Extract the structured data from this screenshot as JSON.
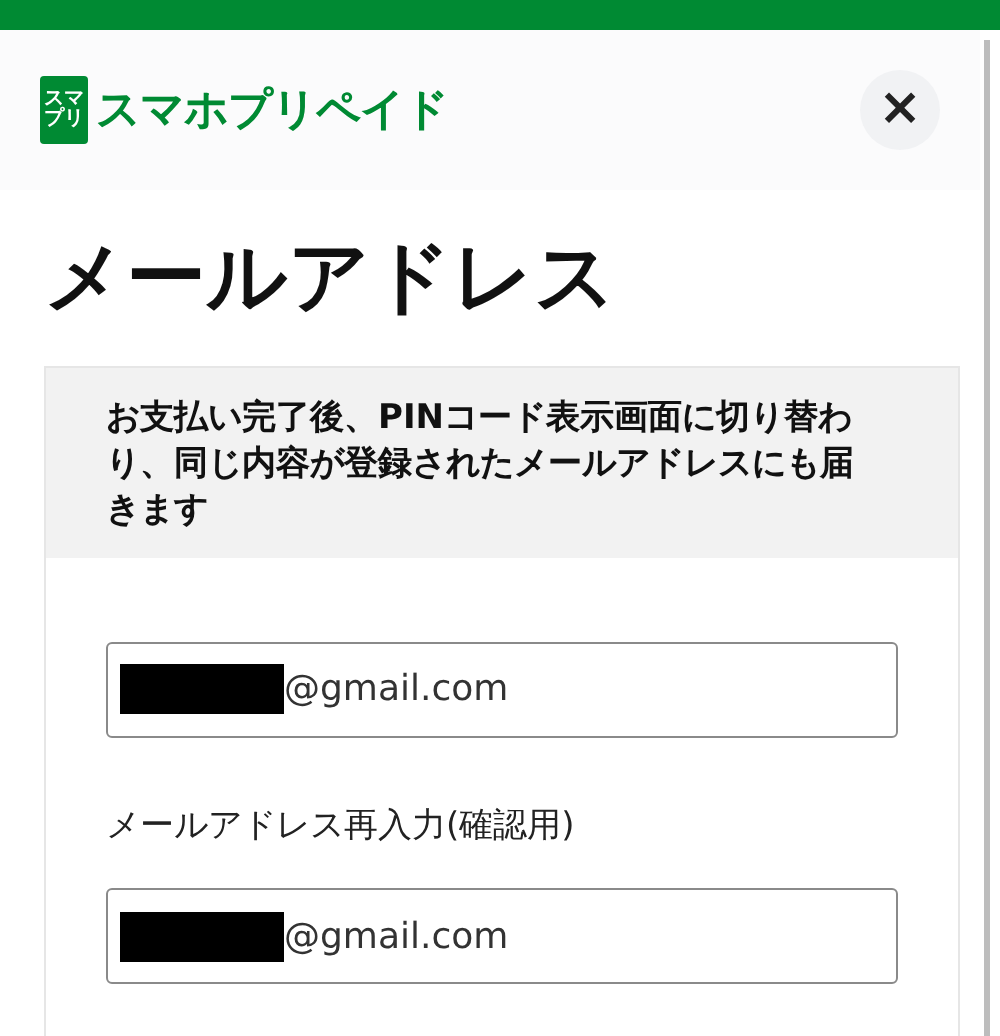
{
  "logo": {
    "badge_lines": [
      "スマ",
      "プリ"
    ],
    "text": "スマホプリペイド"
  },
  "close_button": {
    "label": "×"
  },
  "title": "メールアドレス",
  "notice": "お支払い完了後、PINコード表示画面に切り替わり、同じ内容が登録されたメールアドレスにも届きます",
  "fields": [
    {
      "value": "@gmail.com",
      "redacted": true
    },
    {
      "label": "メールアドレス再入力(確認用)",
      "value": "@gmail.com",
      "redacted": true
    }
  ]
}
